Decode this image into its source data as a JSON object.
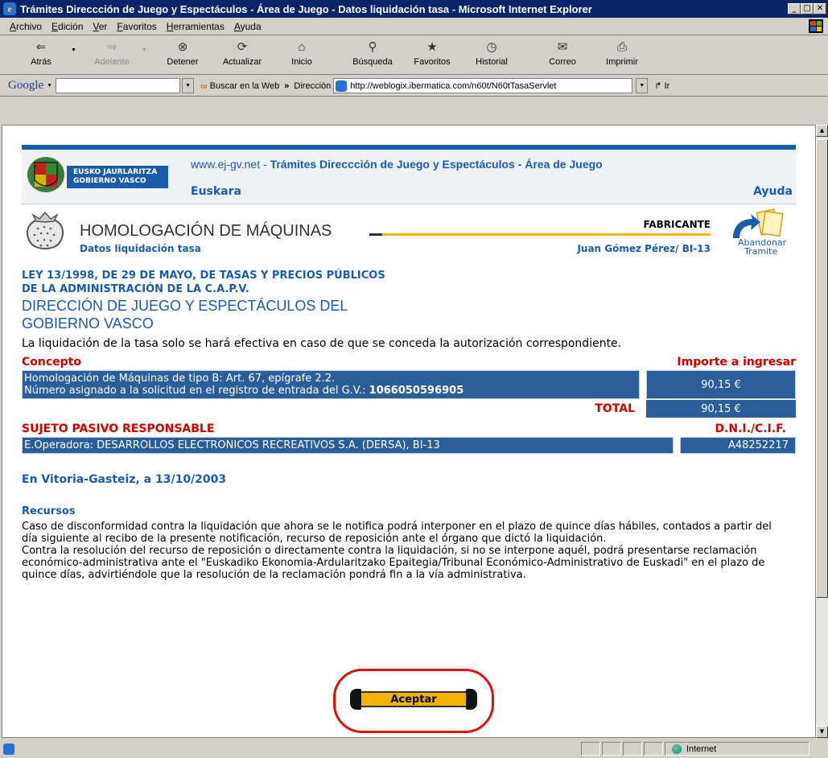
{
  "window": {
    "title": "Trámites Direccción de Juego y Espectáculos - Área de Juego - Datos liquidación tasa - Microsoft Internet Explorer",
    "buttons": [
      "_",
      "□",
      "✕"
    ]
  },
  "menu": [
    "Archivo",
    "Edición",
    "Ver",
    "Favoritos",
    "Herramientas",
    "Ayuda"
  ],
  "toolbar": {
    "back": "Atrás",
    "forward": "Adelante",
    "stop": "Detener",
    "refresh": "Actualizar",
    "home": "Inicio",
    "search": "Búsqueda",
    "favorites": "Favoritos",
    "history": "Historial",
    "mail": "Correo",
    "print": "Imprimir"
  },
  "addressbar": {
    "google_label": "Google",
    "search_web": "Buscar en la Web",
    "address_label": "Dirección",
    "url": "http://weblogix.ibermatica.com/n60t/N60tTasaServlet",
    "go": "Ir"
  },
  "header": {
    "logo_text_1": "EUSKO JAURLARITZA",
    "logo_text_2": "GOBIERNO VASCO",
    "site": "www.ej-gv.net",
    "site_sep": " - ",
    "site_title": "Trámites Direccción de Juego y Espectáculos - Área de Juego",
    "language": "Euskara",
    "help": "Ayuda"
  },
  "section": {
    "title": "HOMOLOGACIÓN DE MÁQUINAS",
    "subtitle": "Datos liquidación tasa",
    "role": "FABRICANTE",
    "user": "Juan Gómez Pérez/ BI-13",
    "abandon_1": "Abandonar",
    "abandon_2": "Tramite"
  },
  "law": {
    "line1": "LEY 13/1998, DE 29 DE MAYO, DE TASAS Y PRECIOS PÚBLICOS",
    "line2": "DE LA ADMINISTRACIÓN DE LA C.A.P.V.",
    "dir1": "DIRECCIÓN DE JUEGO Y ESPECTÁCULOS DEL",
    "dir2": "GOBIERNO VASCO",
    "note": "La liquidación de la tasa solo se hará efectiva en caso de que se conceda la autorización correspondiente."
  },
  "concept_table": {
    "col1": "Concepto",
    "col2": "Importe a ingresar",
    "line1": "Homologación de Máquinas de tipo B: Art. 67, epígrafe 2.2.",
    "line2_prefix": "Número asignado a la solicitud en el registro de entrada del G.V.: ",
    "registry_number": "1066050596905",
    "amount": "90,15 €",
    "total_label": "TOTAL",
    "total_amount": "90,15 €"
  },
  "subject_table": {
    "col1": "SUJETO PASIVO RESPONSABLE",
    "col2": "D.N.I./C.I.F.",
    "name": "E.Operadora: DESARROLLOS ELECTRONICOS RECREATIVOS S.A. (DERSA), BI-13",
    "cif": "A48252217"
  },
  "place_date": "En Vitoria-Gasteiz, a 13/10/2003",
  "recursos": {
    "title": "Recursos",
    "para1": "Caso de disconformidad contra la liquidación que ahora se le notifica podrá interponer en el plazo de quince días hábiles, contados a partir del día siguiente al recibo de la presente notificación, recurso de reposición ante el órgano que dictó la liquidación.",
    "para2": "Contra la resolución del recurso de reposición o directamente contra la liquidación, si no se interpone aquél, podrá presentarse reclamación económico-administrativa ante el \"Euskadiko Ekonomia-Ardularitzako Epaitegia/Tribunal Económico-Administrativo de Euskadi\" en el plazo de quince días, advirtiéndole que la resolución de la reclamación pondrá fin a la vía administrativa."
  },
  "accept_label": "Aceptar",
  "status": {
    "zone": "Internet"
  },
  "colors": {
    "brand_blue": "#1b5ca8",
    "table_blue": "#2b5d99",
    "alert_red": "#d00000",
    "accent_yellow": "#f0b400",
    "highlight_circle": "#e01010"
  }
}
